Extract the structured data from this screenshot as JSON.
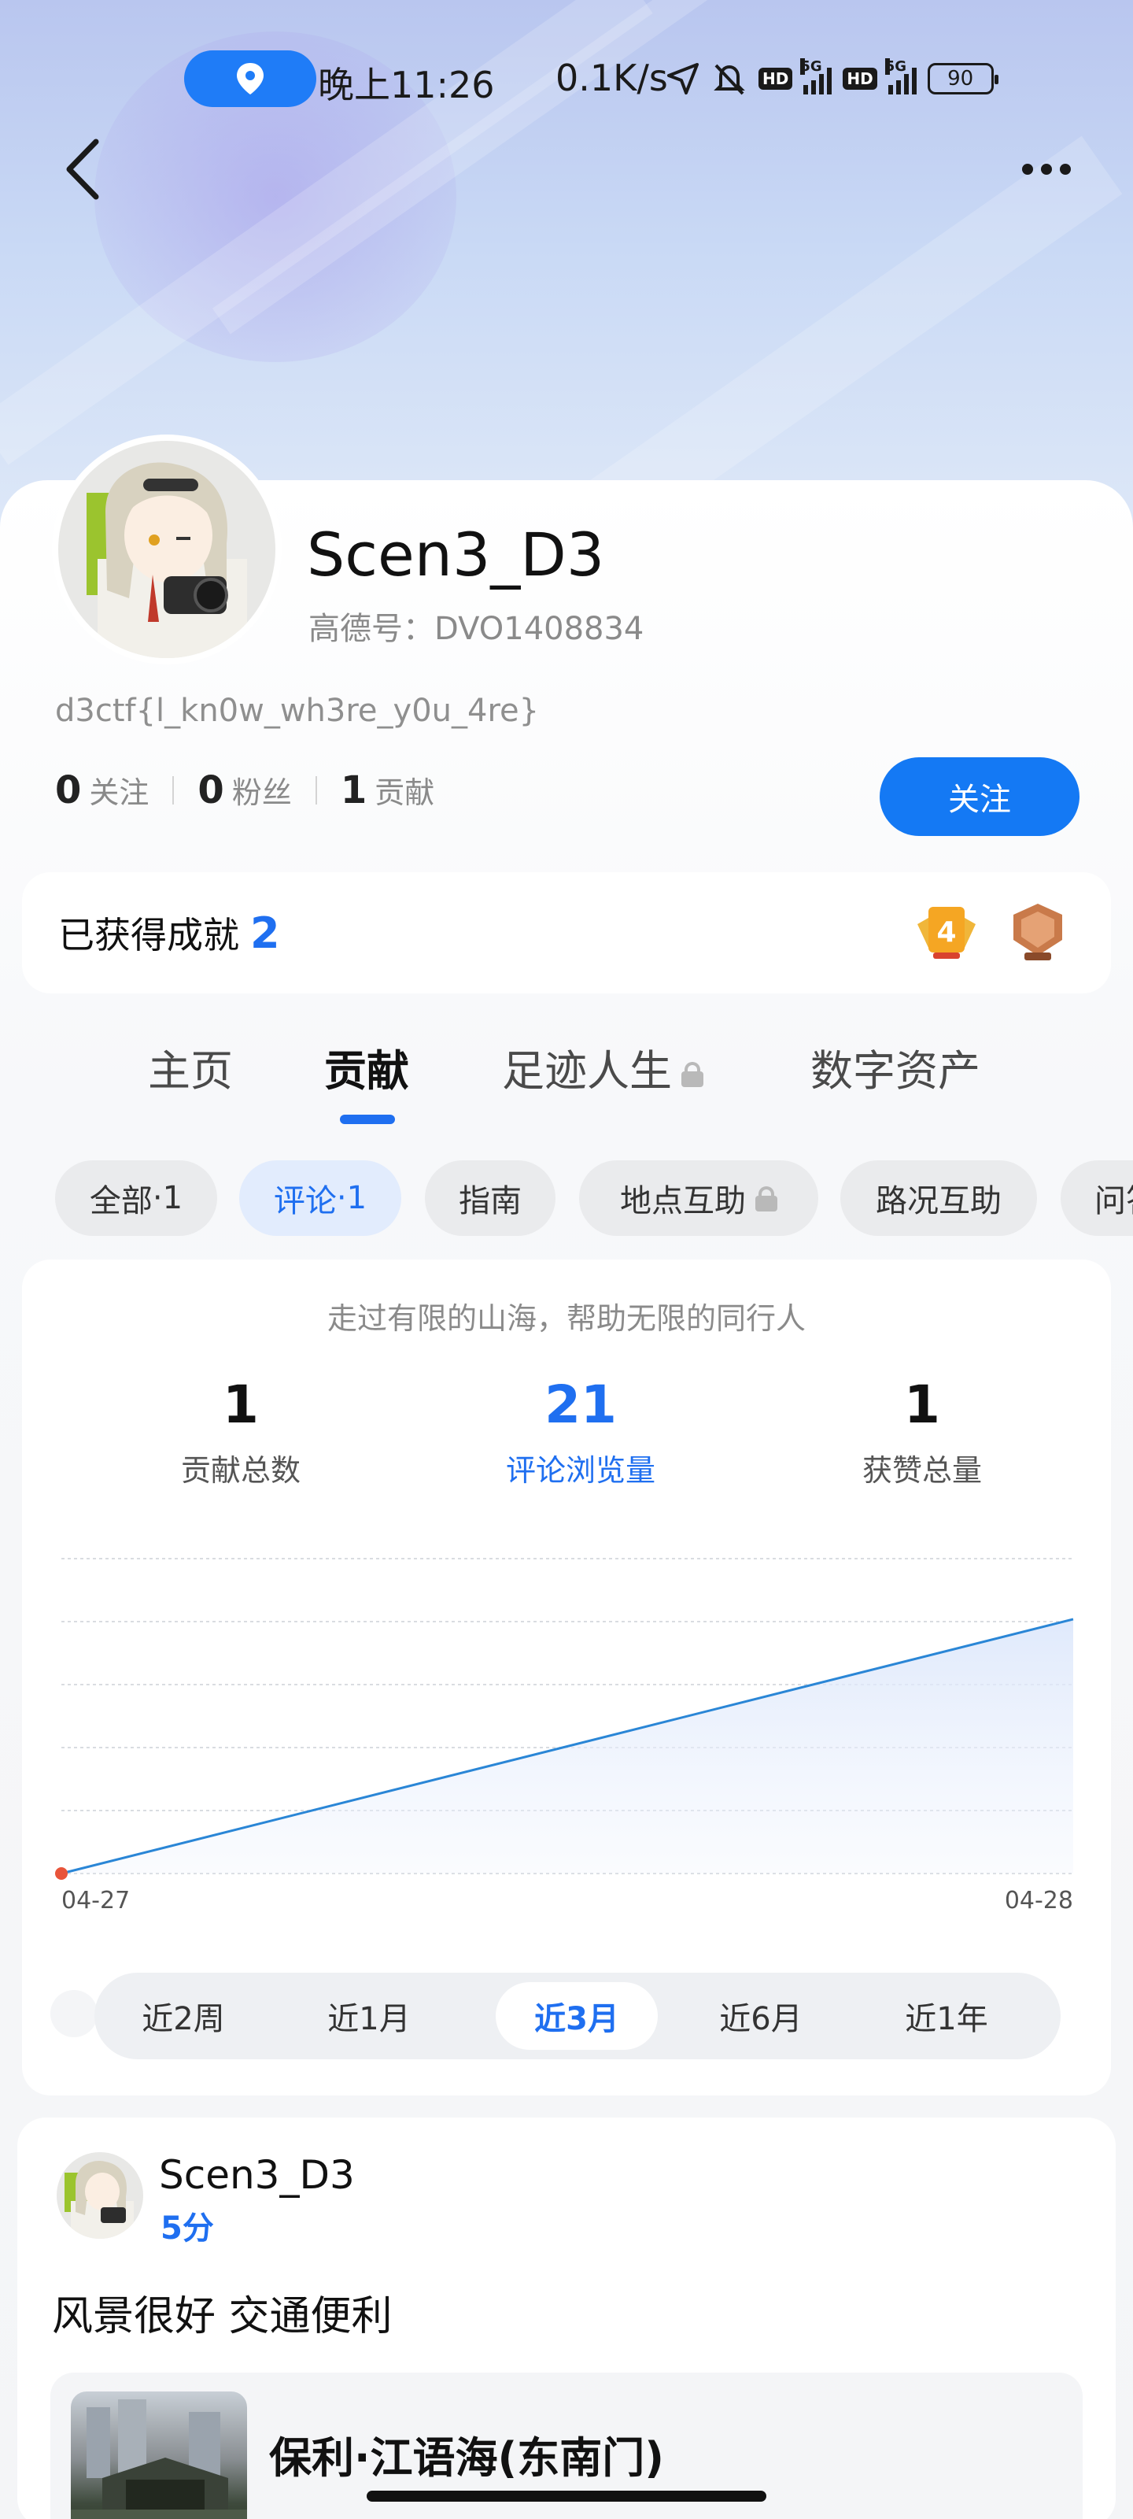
{
  "status_bar": {
    "time": "晚上11:26",
    "network_speed": "0.1K/s",
    "hd_label": "HD",
    "signal_label": "5G",
    "battery": "90"
  },
  "profile": {
    "username": "Scen3_D3",
    "gaode_id": "高德号：DVO1408834",
    "bio": "d3ctf{l_kn0w_wh3re_y0u_4re}",
    "stats": [
      {
        "value": "0",
        "label": "关注"
      },
      {
        "value": "0",
        "label": "粉丝"
      },
      {
        "value": "1",
        "label": "贡献"
      }
    ],
    "follow_button": "关注"
  },
  "achievements": {
    "label": "已获得成就",
    "count": "2",
    "medal_digit": "4"
  },
  "tabs": [
    {
      "label": "主页",
      "active": false
    },
    {
      "label": "贡献",
      "active": true
    },
    {
      "label": "足迹人生",
      "active": false,
      "locked": true
    },
    {
      "label": "数字资产",
      "active": false
    }
  ],
  "filter_chips": [
    {
      "label": "全部",
      "count": "·1",
      "active": false
    },
    {
      "label": "评论",
      "count": "·1",
      "active": true
    },
    {
      "label": "指南",
      "count": "",
      "active": false
    },
    {
      "label": "地点互助",
      "count": "",
      "active": false,
      "locked": true
    },
    {
      "label": "路况互助",
      "count": "",
      "active": false
    },
    {
      "label": "问答",
      "count": "",
      "active": false
    }
  ],
  "stats_card": {
    "slogan": "走过有限的山海，帮助无限的同行人",
    "metrics": [
      {
        "value": "1",
        "label": "贡献总数",
        "active": false
      },
      {
        "value": "21",
        "label": "评论浏览量",
        "active": true
      },
      {
        "value": "1",
        "label": "获赞总量",
        "active": false
      }
    ],
    "time_ranges": [
      {
        "label": "近2周",
        "active": false
      },
      {
        "label": "近1月",
        "active": false
      },
      {
        "label": "近3月",
        "active": true
      },
      {
        "label": "近6月",
        "active": false
      },
      {
        "label": "近1年",
        "active": false
      }
    ]
  },
  "chart_data": {
    "type": "area",
    "title": "",
    "xlabel": "",
    "ylabel": "",
    "x": [
      "04-27",
      "04-28"
    ],
    "series": [
      {
        "values": [
          0,
          21
        ]
      }
    ],
    "ylim": [
      0,
      26
    ],
    "grid": true,
    "line_color": "#2a86d6",
    "fill_color": "#dce7fb",
    "start_marker_color": "#e8543a"
  },
  "review": {
    "username": "Scen3_D3",
    "score": "5分",
    "text": "风景很好 交通便利",
    "poi_name": "保利·江语海(东南门)"
  },
  "colors": {
    "accent": "#1f6ff0",
    "button": "#1479f4",
    "location_pill": "#1f7cf7"
  }
}
